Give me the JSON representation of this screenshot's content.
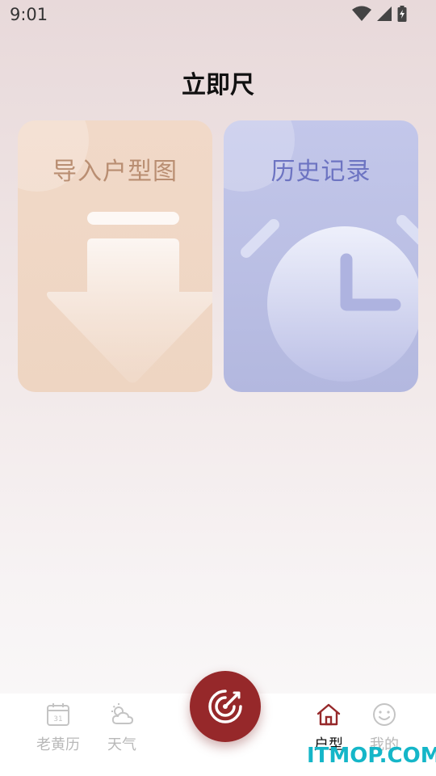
{
  "status_bar": {
    "time": "9:01"
  },
  "page": {
    "title": "立即尺"
  },
  "cards": {
    "import": {
      "label": "导入户型图"
    },
    "history": {
      "label": "历史记录"
    }
  },
  "tabs": {
    "almanac": {
      "label": "老黄历",
      "icon": "calendar-icon"
    },
    "weather": {
      "label": "天气",
      "icon": "weather-icon"
    },
    "floorplan": {
      "label": "户型",
      "icon": "house-icon"
    },
    "profile": {
      "label": "我的",
      "icon": "smiley-icon"
    }
  },
  "fab": {
    "icon": "target-icon"
  },
  "colors": {
    "accent": "#96282a",
    "import_card": "#eed5c2",
    "history_card": "#b3b8df"
  },
  "watermark": {
    "text": "ITMOP.COM"
  }
}
